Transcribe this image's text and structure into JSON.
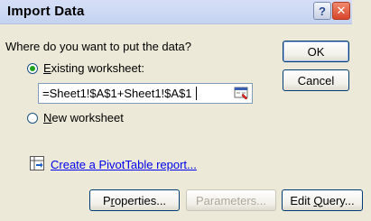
{
  "window": {
    "title": "Import Data"
  },
  "prompt": "Where do you want to put the data?",
  "options": {
    "existing_worksheet": {
      "prefix": "",
      "accel": "E",
      "rest": "xisting worksheet:",
      "selected": true
    },
    "new_worksheet": {
      "prefix": "",
      "accel": "N",
      "rest": "ew worksheet",
      "selected": false
    }
  },
  "reference": {
    "value": "=Sheet1!$A$1+Sheet1!$A$1"
  },
  "pivot_link": "Create a PivotTable report...",
  "buttons": {
    "ok": "OK",
    "cancel": "Cancel",
    "properties": {
      "prefix": "P",
      "accel": "r",
      "rest": "operties..."
    },
    "parameters": "Parameters...",
    "edit_query": {
      "prefix": "Edit ",
      "accel": "Q",
      "rest": "uery..."
    }
  },
  "icons": {
    "help": "help-icon",
    "close": "close-icon",
    "collapse": "collapse-dialog-icon",
    "pivot": "pivottable-icon"
  }
}
